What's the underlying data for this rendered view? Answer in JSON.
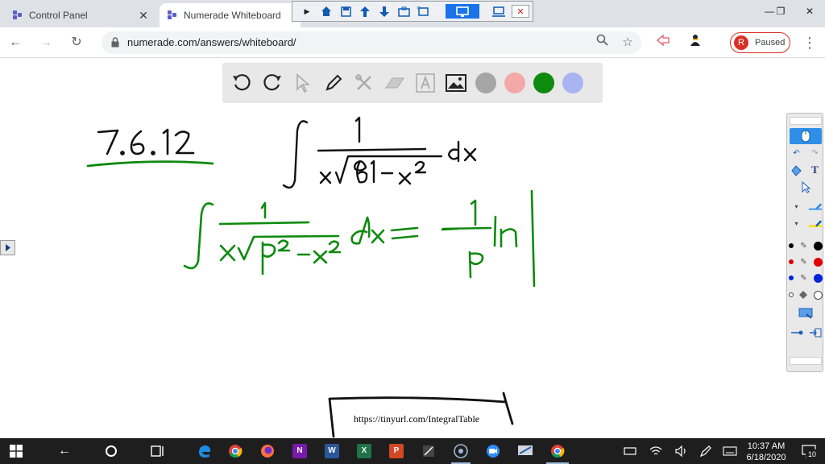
{
  "tabs": [
    {
      "label": "Control Panel",
      "active": false
    },
    {
      "label": "Numerade Whiteboard",
      "active": true
    }
  ],
  "window_controls": {
    "minimize": "—",
    "maximize": "❐",
    "close": "✕"
  },
  "address": {
    "url": "numerade.com/answers/whiteboard/"
  },
  "profile": {
    "initial": "R",
    "status": "Paused"
  },
  "whiteboard": {
    "colors": {
      "gray": "#a6a6a6",
      "pink": "#f4a9a8",
      "green": "#0e8a0e",
      "lavender": "#a9b4f0"
    },
    "link_text": "https://tinyurl.com/IntegralTable"
  },
  "taskbar": {
    "time": "10:37 AM",
    "date": "6/18/2020",
    "notification_count": "10",
    "apps": [
      {
        "name": "OneNote",
        "letter": "N",
        "color": "#7719aa"
      },
      {
        "name": "Word",
        "letter": "W",
        "color": "#2b579a"
      },
      {
        "name": "Excel",
        "letter": "X",
        "color": "#217346"
      },
      {
        "name": "PowerPoint",
        "letter": "P",
        "color": "#d24726"
      }
    ]
  }
}
